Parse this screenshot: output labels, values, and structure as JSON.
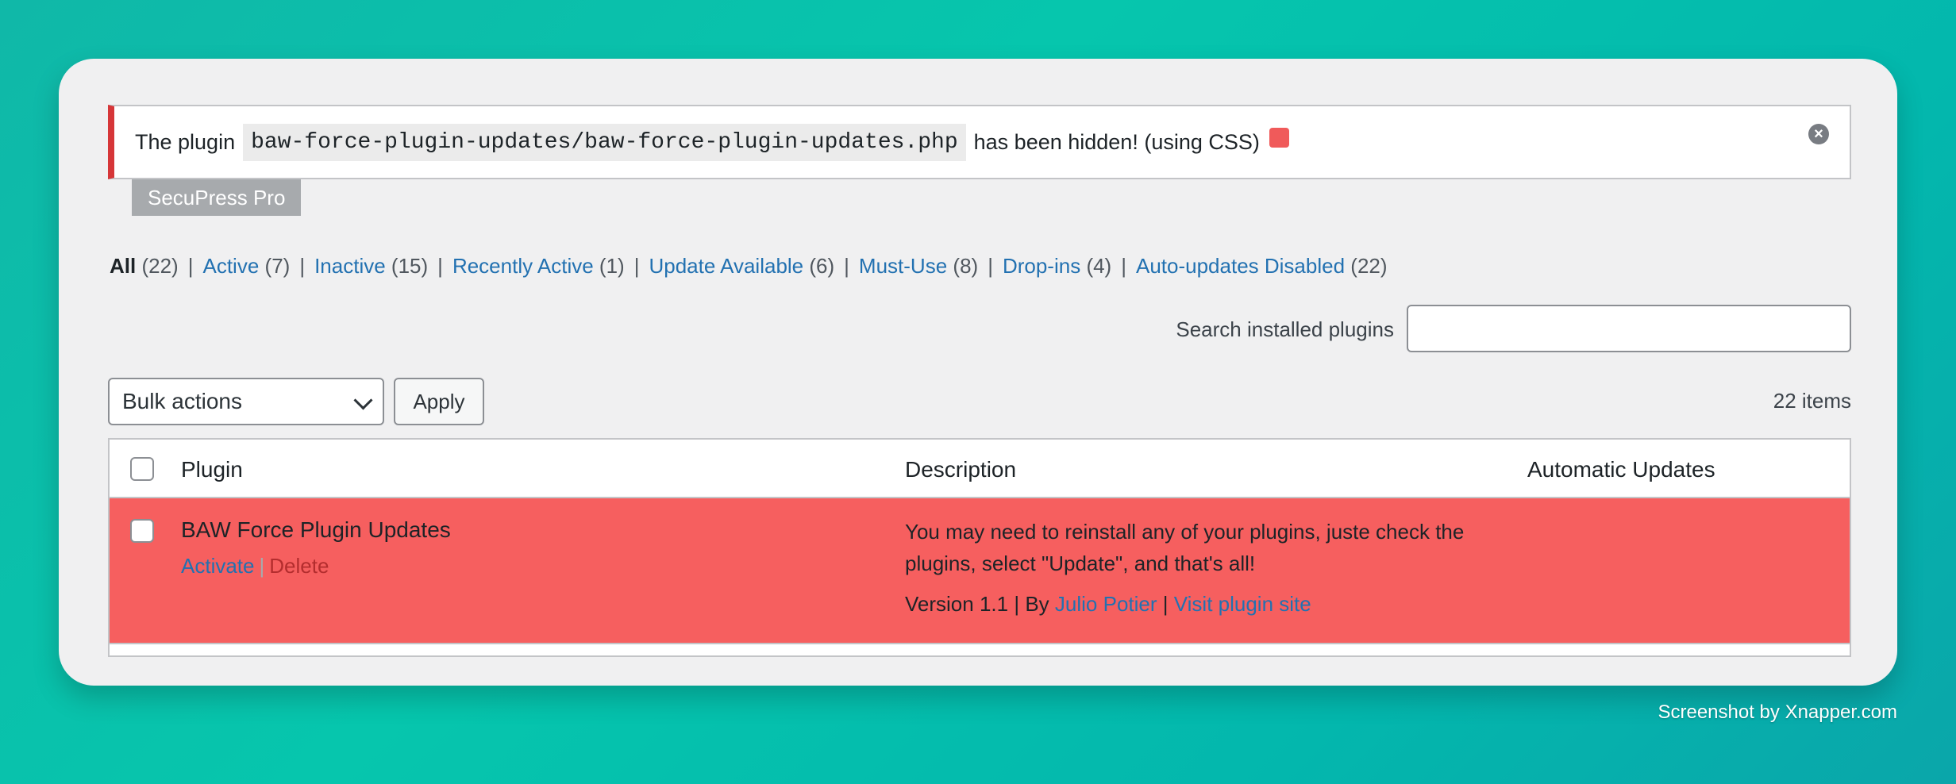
{
  "notice": {
    "prefix": "The plugin",
    "code": "baw-force-plugin-updates/baw-force-plugin-updates.php",
    "suffix": "has been hidden! (using CSS)",
    "indicator_color": "#f05a5a",
    "dismiss_icon": "close-circle-icon"
  },
  "badge": "SecuPress Pro",
  "filters": [
    {
      "label": "All",
      "count": "(22)",
      "current": true
    },
    {
      "label": "Active",
      "count": "(7)"
    },
    {
      "label": "Inactive",
      "count": "(15)"
    },
    {
      "label": "Recently Active",
      "count": "(1)"
    },
    {
      "label": "Update Available",
      "count": "(6)"
    },
    {
      "label": "Must-Use",
      "count": "(8)"
    },
    {
      "label": "Drop-ins",
      "count": "(4)"
    },
    {
      "label": "Auto-updates Disabled",
      "count": "(22)"
    }
  ],
  "filter_separator": "|",
  "search": {
    "label": "Search installed plugins",
    "value": ""
  },
  "toolbar": {
    "bulk_actions": "Bulk actions",
    "apply": "Apply",
    "item_count": "22 items"
  },
  "table": {
    "columns": [
      "Plugin",
      "Description",
      "Automatic Updates"
    ],
    "row": {
      "name": "BAW Force Plugin Updates",
      "activate": "Activate",
      "pipe": "|",
      "delete": "Delete",
      "description": "You may need to reinstall any of your plugins, juste check the plugins, select \"Update\", and that's all!",
      "version": "Version 1.1",
      "by": "By",
      "author": "Julio Potier",
      "site_link": "Visit plugin site",
      "highlight_color": "#f65f5f"
    }
  },
  "credit": "Screenshot by Xnapper.com",
  "colors": {
    "accent": "#2271b1",
    "error": "#d63638"
  }
}
